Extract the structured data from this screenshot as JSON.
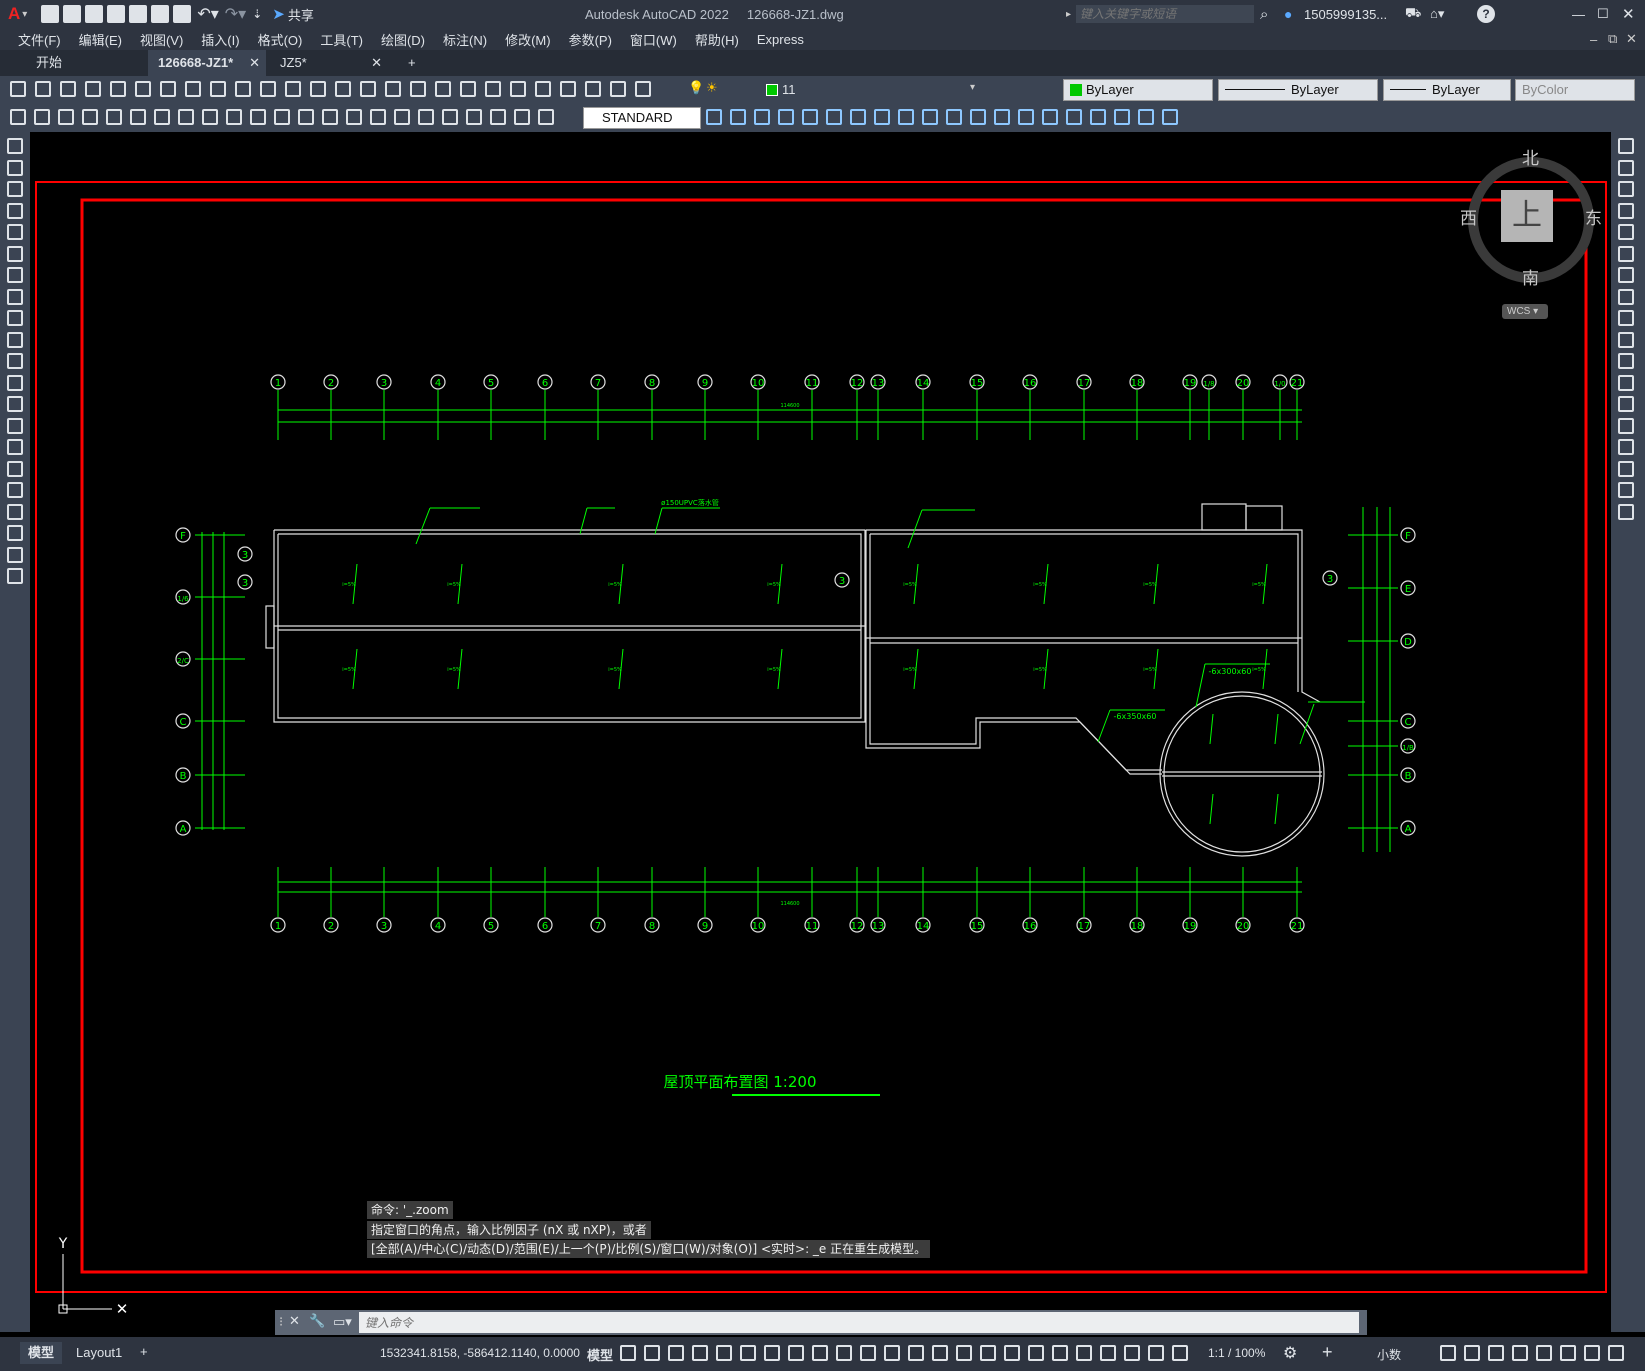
{
  "app": {
    "title": "Autodesk AutoCAD 2022",
    "file": "126668-JZ1.dwg",
    "share_label": "共享",
    "search_placeholder": "键入关键字或短语",
    "user": "1505999135..."
  },
  "menu": [
    "文件(F)",
    "编辑(E)",
    "视图(V)",
    "插入(I)",
    "格式(O)",
    "工具(T)",
    "绘图(D)",
    "标注(N)",
    "修改(M)",
    "参数(P)",
    "窗口(W)",
    "帮助(H)",
    "Express"
  ],
  "tabs": [
    {
      "label": "开始",
      "active": false
    },
    {
      "label": "126668-JZ1*",
      "active": true
    },
    {
      "label": "JZ5*",
      "active": false
    }
  ],
  "toolbar": {
    "layer": "11",
    "color": "ByLayer",
    "linetype": "ByLayer",
    "lineweight": "ByLayer",
    "plotstyle": "ByColor",
    "textstyle": "STANDARD"
  },
  "colors": {
    "accent_green": "#00ff00",
    "frame_red": "#ff0000",
    "layer_swatch": "#00c800"
  },
  "viewcube": {
    "north": "北",
    "south": "南",
    "east": "东",
    "west": "西",
    "top": "上",
    "wcs": "WCS"
  },
  "drawing": {
    "title": "屋顶平面布置图 1:200",
    "axis_numbers_top": [
      "1",
      "2",
      "3",
      "4",
      "5",
      "6",
      "7",
      "8",
      "9",
      "10",
      "11",
      "12",
      "13",
      "14",
      "15",
      "16",
      "17",
      "18",
      "19",
      "1/8",
      "20",
      "1/0",
      "21"
    ],
    "axis_numbers_bottom": [
      "1",
      "2",
      "3",
      "4",
      "5",
      "6",
      "7",
      "8",
      "9",
      "10",
      "11",
      "12",
      "13",
      "14",
      "15",
      "16",
      "17",
      "18",
      "19",
      "20",
      "21"
    ],
    "axis_letters_left": [
      "F",
      "1/6",
      "2/C",
      "C",
      "B",
      "A"
    ],
    "axis_letters_right": [
      "F",
      "E",
      "D",
      "C",
      "1/B",
      "B",
      "A"
    ],
    "pipe_label": "ø150UPVC落水管",
    "beam_label_1": "-6x300x60",
    "beam_label_2": "-6x350x60",
    "dim_total": "114600"
  },
  "command": {
    "history": [
      "命令: '_.zoom",
      "指定窗口的角点，输入比例因子 (nX 或 nXP)，或者",
      "[全部(A)/中心(C)/动态(D)/范围(E)/上一个(P)/比例(S)/窗口(W)/对象(O)] <实时>: _e 正在重生成模型。"
    ],
    "input_placeholder": "键入命令"
  },
  "status": {
    "model_tab": "模型",
    "layout_tab": "Layout1",
    "coords": "1532341.8158, -586412.1140, 0.0000",
    "mode": "模型",
    "scale": "1:1 / 100%",
    "units": "小数"
  }
}
